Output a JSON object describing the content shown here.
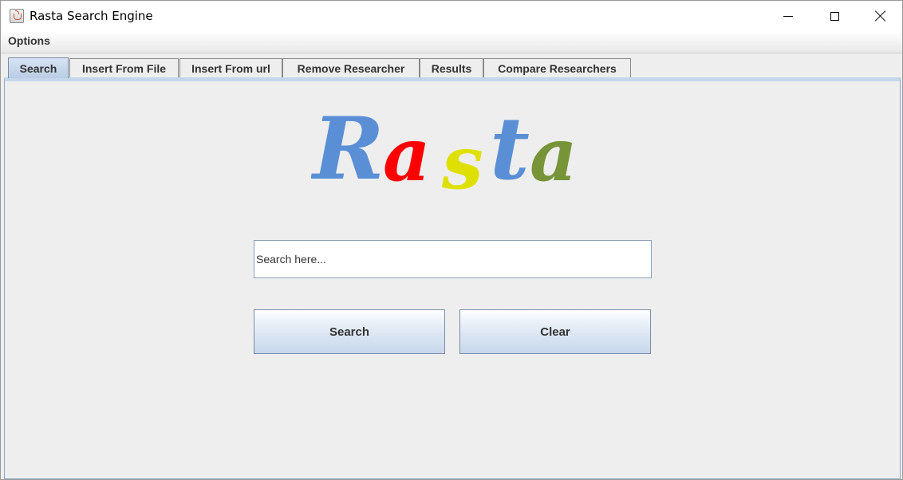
{
  "window": {
    "title": "Rasta Search Engine"
  },
  "menu": {
    "options_label": "Options"
  },
  "tabs": [
    {
      "label": "Search",
      "active": true
    },
    {
      "label": "Insert From File",
      "active": false
    },
    {
      "label": "Insert From url",
      "active": false
    },
    {
      "label": "Remove Researcher",
      "active": false
    },
    {
      "label": "Results",
      "active": false
    },
    {
      "label": "Compare Researchers",
      "active": false
    }
  ],
  "logo": {
    "letters": [
      {
        "char": "R",
        "color": "#5a8fd6"
      },
      {
        "char": "a",
        "color": "#ff0000"
      },
      {
        "char": "s",
        "color": "#e0e000"
      },
      {
        "char": "t",
        "color": "#5a8fd6"
      },
      {
        "char": "a",
        "color": "#779438"
      }
    ]
  },
  "search": {
    "value": "Search here..."
  },
  "buttons": {
    "search_label": "Search",
    "clear_label": "Clear"
  }
}
